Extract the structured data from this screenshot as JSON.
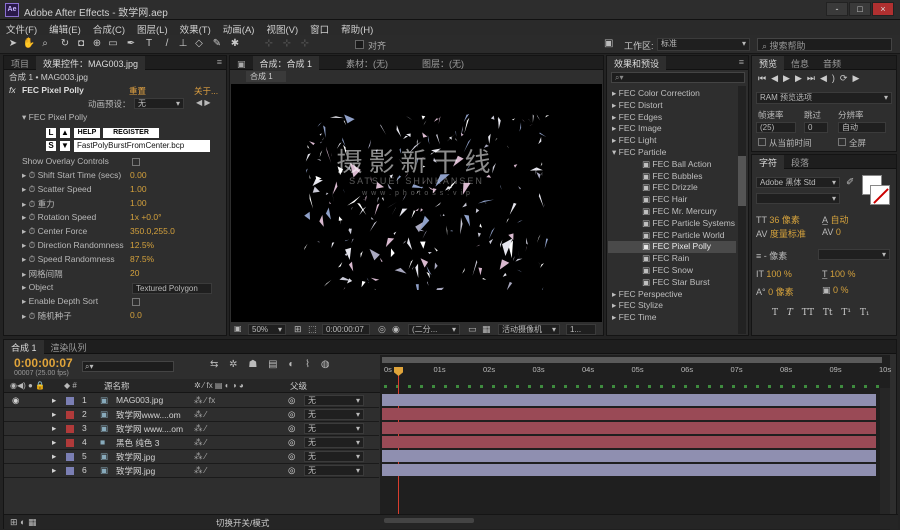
{
  "app": {
    "title": "Adobe After Effects - 致学网.aep",
    "icon": "Ae"
  },
  "window_buttons": [
    "-",
    "□",
    "×"
  ],
  "menu": [
    "文件(F)",
    "编辑(E)",
    "合成(C)",
    "图层(L)",
    "效果(T)",
    "动画(A)",
    "视图(V)",
    "窗口",
    "帮助(H)"
  ],
  "toolbar": {
    "align_label": "对齐",
    "workspace_label": "工作区:",
    "workspace_value": "标准",
    "search_placeholder": "搜索帮助"
  },
  "left_panel": {
    "tabs": [
      "项目",
      "效果控件：MAG003.jpg"
    ],
    "comp_path": "合成 1 • MAG003.jpg",
    "effect_name": "FEC Pixel Polly",
    "reset": "重置",
    "about": "关于...",
    "preset_label": "动画预设：",
    "preset_value": "无",
    "sub_name": "FEC Pixel Polly",
    "help_btn": "HELP",
    "register_btn": "REGISTER",
    "file": "FastPolyBurstFromCenter.bcp",
    "props": [
      {
        "name": "Show Overlay Controls",
        "value": ""
      },
      {
        "name": "Shift Start Time (secs)",
        "value": "0.00"
      },
      {
        "name": "Scatter Speed",
        "value": "1.00"
      },
      {
        "name": "重力",
        "value": "1.00"
      },
      {
        "name": "Rotation Speed",
        "value": "1x +0.0°"
      },
      {
        "name": "Center Force",
        "value": "350.0,255.0"
      },
      {
        "name": "Direction Randomness",
        "value": "12.5%"
      },
      {
        "name": "Speed Randomness",
        "value": "87.5%"
      },
      {
        "name": "网格间隔",
        "value": "20"
      },
      {
        "name": "Object",
        "value": "Textured Polygon"
      },
      {
        "name": "Enable Depth Sort",
        "value": ""
      },
      {
        "name": "随机种子",
        "value": "0.0"
      }
    ]
  },
  "viewer": {
    "tabs": [
      "合成：合成 1",
      "素材：(无)",
      "图层：(无)"
    ],
    "comp_tab": "合成 1",
    "zoom": "50%",
    "time": "0:00:00:07",
    "resolution": "(二分...",
    "camera": "活动摄像机",
    "views": "1..."
  },
  "effects_panel": {
    "tab": "效果和预设",
    "items": [
      {
        "label": "FEC Color Correction",
        "sub": false,
        "sel": false
      },
      {
        "label": "FEC Distort",
        "sub": false,
        "sel": false
      },
      {
        "label": "FEC Edges",
        "sub": false,
        "sel": false
      },
      {
        "label": "FEC Image",
        "sub": false,
        "sel": false
      },
      {
        "label": "FEC Light",
        "sub": false,
        "sel": false
      },
      {
        "label": "FEC Particle",
        "sub": false,
        "sel": false
      },
      {
        "label": "FEC Ball Action",
        "sub": true,
        "sel": false
      },
      {
        "label": "FEC Bubbles",
        "sub": true,
        "sel": false
      },
      {
        "label": "FEC Drizzle",
        "sub": true,
        "sel": false
      },
      {
        "label": "FEC Hair",
        "sub": true,
        "sel": false
      },
      {
        "label": "FEC Mr. Mercury",
        "sub": true,
        "sel": false
      },
      {
        "label": "FEC Particle Systems II",
        "sub": true,
        "sel": false
      },
      {
        "label": "FEC Particle World",
        "sub": true,
        "sel": false
      },
      {
        "label": "FEC Pixel Polly",
        "sub": true,
        "sel": true
      },
      {
        "label": "FEC Rain",
        "sub": true,
        "sel": false
      },
      {
        "label": "FEC Snow",
        "sub": true,
        "sel": false
      },
      {
        "label": "FEC Star Burst",
        "sub": true,
        "sel": false
      },
      {
        "label": "FEC Perspective",
        "sub": false,
        "sel": false
      },
      {
        "label": "FEC Stylize",
        "sub": false,
        "sel": false
      },
      {
        "label": "FEC Time",
        "sub": false,
        "sel": false
      }
    ]
  },
  "preview_panel": {
    "tabs": [
      "预览",
      "信息",
      "音频"
    ],
    "ram_preview": "RAM 预览选项",
    "fps_label": "帧速率",
    "skip_label": "跳过",
    "res_label": "分辨率",
    "fps_value": "(25)",
    "skip_value": "0",
    "res_value": "自动",
    "from_current": "从当前时间",
    "fullscreen": "全屏"
  },
  "char_panel": {
    "tabs": [
      "字符",
      "段落"
    ],
    "font": "Adobe 黑体 Std",
    "size": "36 像素",
    "leading": "自动",
    "kerning": "度量标准",
    "tracking": "0",
    "stroke": "- 像素",
    "vscale": "100 %",
    "hscale": "100 %",
    "baseline": "0 像素",
    "tsume": "0 %",
    "styles": [
      "T",
      "T",
      "TT",
      "Tt",
      "T¹",
      "T₁"
    ]
  },
  "timeline": {
    "tabs": [
      "合成 1",
      "渲染队列"
    ],
    "timecode": "0:00:00:07",
    "frame_info": "00007 (25.00 fps)",
    "col_source": "源名称",
    "col_parent": "父级",
    "ticks": [
      "0s",
      "01s",
      "02s",
      "03s",
      "04s",
      "05s",
      "06s",
      "07s",
      "08s",
      "09s",
      "10s"
    ],
    "bottom_label": "切换开关/模式",
    "layers": [
      {
        "num": "1",
        "name": "MAG003.jpg",
        "color": "#7b7fb4",
        "parent": "无",
        "bar": "#8f8fb0"
      },
      {
        "num": "2",
        "name": "致学网www....om",
        "color": "#b03a3a",
        "parent": "无",
        "bar": "#9a4a56"
      },
      {
        "num": "3",
        "name": "致学网 www....om",
        "color": "#b03a3a",
        "parent": "无",
        "bar": "#9a4a56"
      },
      {
        "num": "4",
        "name": "黑色 纯色 3",
        "color": "#b03a3a",
        "parent": "无",
        "bar": "#9a4a56"
      },
      {
        "num": "5",
        "name": "致学网.jpg",
        "color": "#7b7fb4",
        "parent": "无",
        "bar": "#8f8fb0"
      },
      {
        "num": "6",
        "name": "致学网.jpg",
        "color": "#7b7fb4",
        "parent": "无",
        "bar": "#8f8fb0"
      }
    ]
  },
  "watermark": {
    "text": "摄影新干线",
    "sub": "SATSUEI SHINKANSEN",
    "url": "w w w . p h o t o s s . v i p"
  }
}
